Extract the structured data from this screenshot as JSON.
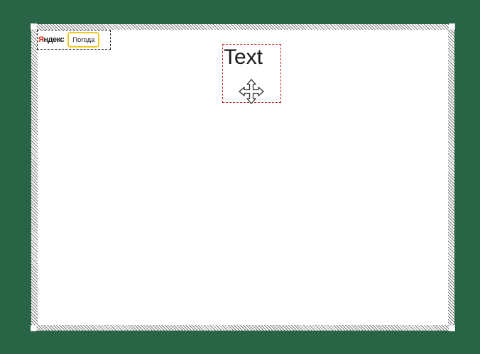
{
  "widget": {
    "logo_first": "Я",
    "logo_rest": "ндекс",
    "button_label": "Погода"
  },
  "text_element": {
    "content": "Text"
  },
  "icons": {
    "move": "move-arrows-icon"
  },
  "colors": {
    "background": "#2a6446",
    "canvas": "#ffffff",
    "text_border": "#c0262b",
    "widget_button_border": "#f0c928",
    "logo_accent": "#e32b1c"
  }
}
